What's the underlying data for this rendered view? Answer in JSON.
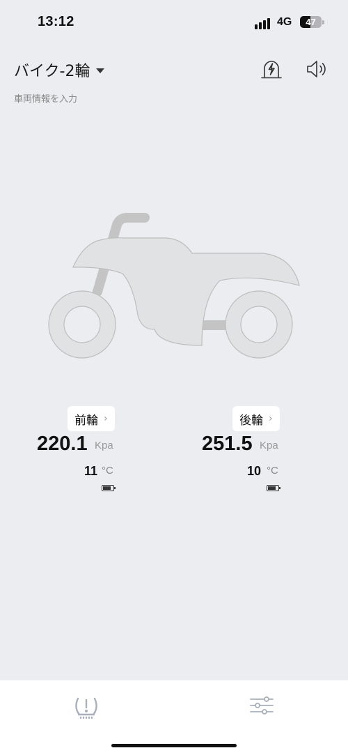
{
  "status_bar": {
    "time": "13:12",
    "network": "4G",
    "battery": "47",
    "battery_level": 0.47
  },
  "header": {
    "vehicle_name": "バイク-2輪",
    "subtitle": "車両情報を入力",
    "icons": [
      "alarm-light-icon",
      "speaker-icon"
    ]
  },
  "tires": {
    "front": {
      "label": "前輪",
      "pressure": "220.1",
      "pressure_unit": "Kpa",
      "temperature": "11",
      "temperature_unit": "°C",
      "battery_level": 0.8
    },
    "rear": {
      "label": "後輪",
      "pressure": "251.5",
      "pressure_unit": "Kpa",
      "temperature": "10",
      "temperature_unit": "°C",
      "battery_level": 0.8
    }
  },
  "tab_bar": {
    "items": [
      {
        "icon": "tire-pressure-warning-icon",
        "active": true
      },
      {
        "icon": "settings-sliders-icon",
        "active": false
      }
    ]
  },
  "colors": {
    "background": "#ECEDF0",
    "motorcycle_fill": "#E1E2E3",
    "motorcycle_stroke": "#BDBDBD",
    "tab_bar": "#FFFFFF"
  }
}
